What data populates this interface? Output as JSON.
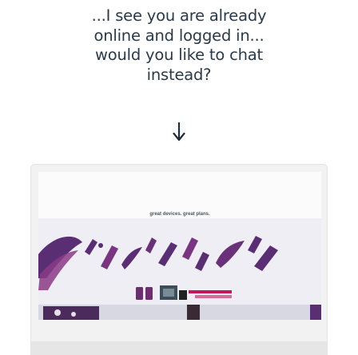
{
  "prompt": {
    "lines": [
      "...I see you are already",
      "online and logged in...",
      "would you like to chat",
      "instead?"
    ],
    "text_color": "#2b3a48"
  },
  "arrow": {
    "icon": "chevron-down-arrow-icon",
    "color": "#1f2d3a"
  },
  "monitor_screen": {
    "tagline": "great devices. great plans.",
    "banner_colors": {
      "hero_purple": "#5a2e73",
      "hero_magenta": "#8b3a86",
      "hero_bg": "#eeeef4",
      "promo_pink": "#c2185b"
    }
  }
}
